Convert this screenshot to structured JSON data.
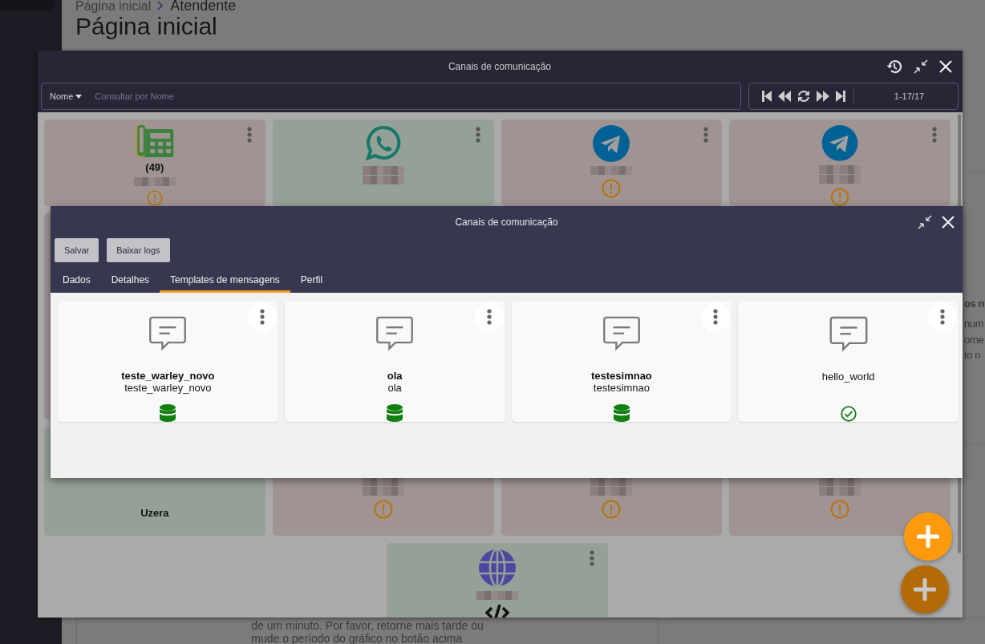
{
  "page": {
    "breadcrumb": [
      "Página inicial",
      "Atendente"
    ],
    "title": "Página inicial",
    "notice_lines": [
      "de um minuto. Por favor, retorne mais tarde ou",
      "mude o período do gráfico no botão acima"
    ],
    "side_heading": "os n",
    "side_lines": [
      "num",
      "orne",
      "to n"
    ]
  },
  "channels_window": {
    "title": "Canais de comunicação",
    "filter": "Nome",
    "search": {
      "placeholder": "Consultar por Nome"
    },
    "range": "1-17/17",
    "channels": [
      {
        "kind": "phone",
        "color": "#a09493",
        "warning": true,
        "label": "(49)"
      },
      {
        "kind": "whatsapp",
        "color": "#95a096",
        "warning": false
      },
      {
        "kind": "telegram",
        "color": "#a09493",
        "warning": true
      },
      {
        "kind": "telegram",
        "color": "#a09493",
        "warning": true
      },
      {
        "kind": "blank",
        "color": "#a09493",
        "warning": false
      },
      {
        "kind": "blank",
        "color": "#95a096",
        "warning": false,
        "label": "Uzera"
      },
      {
        "kind": "blank",
        "color": "#a09493",
        "warning": true
      },
      {
        "kind": "blank",
        "color": "#a09493",
        "warning": true
      },
      {
        "kind": "blank",
        "color": "#a09493",
        "warning": true
      },
      {
        "kind": "web",
        "color": "#95a096",
        "warning": false
      }
    ]
  },
  "template_window": {
    "title": "Canais de comunicação",
    "buttons": [
      "Salvar",
      "Baixar logs"
    ],
    "tabs": [
      {
        "label": "Dados",
        "selected": false
      },
      {
        "label": "Detalhes",
        "selected": false
      },
      {
        "label": "Templates de mensagens",
        "selected": true
      },
      {
        "label": "Perfil",
        "selected": false
      }
    ],
    "templates": [
      {
        "title": "teste_warley_novo",
        "subtitle": "teste_warley_novo",
        "kind": "stored"
      },
      {
        "title": "ola",
        "subtitle": "ola",
        "kind": "stored"
      },
      {
        "title": "testesimnao",
        "subtitle": "testesimnao",
        "kind": "stored"
      },
      {
        "subtitle": "hello_world",
        "kind": "approved"
      }
    ]
  }
}
